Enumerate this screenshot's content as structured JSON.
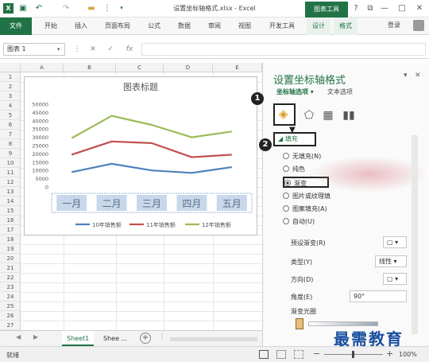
{
  "titlebar": {
    "app_icon": "X",
    "window_title": "设置坐标轴格式.xlsx - Excel",
    "chart_tools": "图表工具",
    "help": "?",
    "restore": "⧉",
    "minimize": "—",
    "maximize": "□",
    "close": "✕"
  },
  "ribbon": {
    "tabs": [
      "文件",
      "开始",
      "插入",
      "页面布局",
      "公式",
      "数据",
      "审阅",
      "视图",
      "开发工具",
      "设计",
      "格式"
    ],
    "login": "登录"
  },
  "formula_bar": {
    "name_box": "图表 1",
    "cancel": "✕",
    "enter": "✓",
    "fx": "fx"
  },
  "grid": {
    "columns": [
      "A",
      "B",
      "C",
      "D",
      "E"
    ],
    "rows": [
      "1",
      "2",
      "3",
      "4",
      "5",
      "6",
      "7",
      "8",
      "9",
      "10",
      "11",
      "12",
      "13",
      "14",
      "15",
      "16",
      "17",
      "18",
      "19",
      "20",
      "21",
      "22",
      "23",
      "24",
      "25",
      "26",
      "27"
    ]
  },
  "chart_data": {
    "type": "line",
    "title": "图表标题",
    "categories": [
      "一月",
      "二月",
      "三月",
      "四月",
      "五月"
    ],
    "series": [
      {
        "name": "10年销售额",
        "color": "#4f81bd",
        "values": [
          9000,
          14000,
          10000,
          8500,
          12000
        ]
      },
      {
        "name": "11年销售额",
        "color": "#c0504d",
        "values": [
          19500,
          27500,
          26500,
          18000,
          19500
        ]
      },
      {
        "name": "12年销售额",
        "color": "#9bbb59",
        "values": [
          29500,
          43000,
          37500,
          30000,
          33500
        ]
      }
    ],
    "ylim": [
      0,
      50000
    ],
    "yticks": [
      "50000",
      "45000",
      "40000",
      "35000",
      "30000",
      "25000",
      "20000",
      "15000",
      "10000",
      "5000",
      "0"
    ],
    "legend": "bottom",
    "grid": false
  },
  "sheets": [
    "Sheet1",
    "Shee ..."
  ],
  "status": {
    "ready": "就绪",
    "zoom": "100%"
  },
  "pane": {
    "title": "设置坐标轴格式",
    "tab_axis": "坐标轴选项",
    "tab_text": "文本选项",
    "section": "填充",
    "fill_options": [
      "无填充(N)",
      "纯色",
      "渐变",
      "图片或纹理填",
      "图案填充(A)",
      "自动(U)"
    ],
    "selected_fill": 2,
    "props": [
      {
        "label": "预设渐变(R)",
        "value": ""
      },
      {
        "label": "类型(Y)",
        "value": "线性"
      },
      {
        "label": "方向(D)",
        "value": ""
      },
      {
        "label": "角度(E)",
        "value": "90°"
      },
      {
        "label": "渐变光圈",
        "value": ""
      }
    ],
    "callouts": [
      "1",
      "2"
    ]
  },
  "watermark": "最需教育"
}
